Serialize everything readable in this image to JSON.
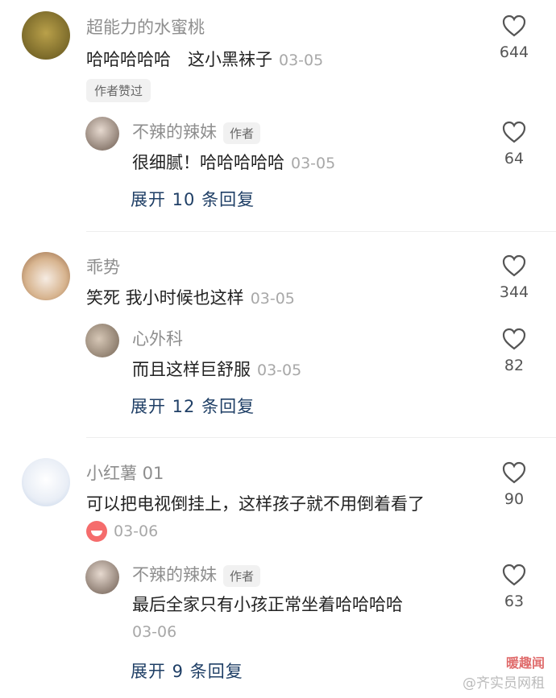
{
  "comments": [
    {
      "name": "超能力的水蜜桃",
      "text": "哈哈哈哈哈　这小黑袜子",
      "time": "03-05",
      "likes": "644",
      "badge": "作者赞过",
      "reply": {
        "name": "不辣的辣妹",
        "tag": "作者",
        "text": "很细腻！哈哈哈哈哈",
        "time": "03-05",
        "likes": "64"
      },
      "expand": "展开 10 条回复"
    },
    {
      "name": "乖势",
      "text": "笑死 我小时候也这样",
      "time": "03-05",
      "likes": "344",
      "reply": {
        "name": "心外科",
        "text": "而且这样巨舒服",
        "time": "03-05",
        "likes": "82"
      },
      "expand": "展开 12 条回复"
    },
    {
      "name": "小红薯 01",
      "text": "可以把电视倒挂上，这样孩子就不用倒着看了",
      "time": "03-06",
      "likes": "90",
      "reply": {
        "name": "不辣的辣妹",
        "tag": "作者",
        "text": "最后全家只有小孩正常坐着哈哈哈哈",
        "time": "03-06",
        "likes": "63"
      },
      "expand": "展开 9 条回复"
    }
  ],
  "watermark": "@齐实员网租",
  "watermark_logo": "暖趣闻",
  "icons": {
    "like": "heart-outline-icon",
    "emoji": "laughing-face-icon"
  }
}
